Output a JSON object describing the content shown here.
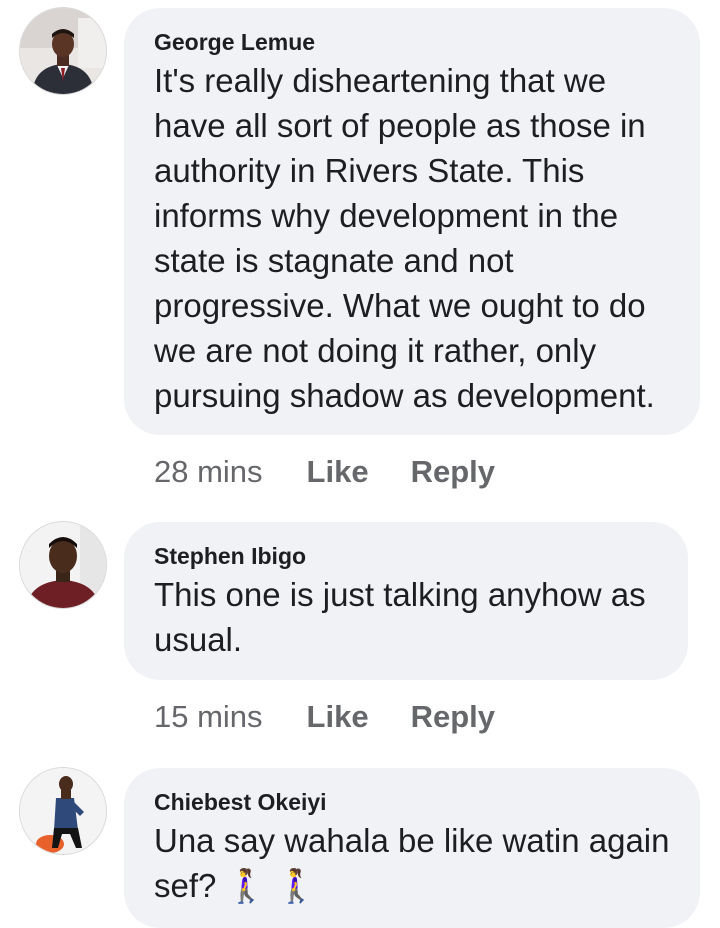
{
  "comments": [
    {
      "author": "George Lemue",
      "text": "It's really disheartening that we\nhave all sort of people as those in\nauthority  in Rivers State. This\ninforms why  development in the\nstate is stagnate and not\nprogressive. What we ought to do\nwe are not doing it rather, only\npursuing shadow as development.",
      "time": "28 mins",
      "like_label": "Like",
      "reply_label": "Reply"
    },
    {
      "author": "Stephen Ibigo",
      "text": "This one is just talking anyhow as\nusual.",
      "time": "15 mins",
      "like_label": "Like",
      "reply_label": "Reply"
    },
    {
      "author": "Chiebest Okeiyi",
      "text": "Una say wahala be like watin again\nsef? 🚶‍♀️ 🚶‍♀️",
      "time": "",
      "like_label": "",
      "reply_label": ""
    }
  ]
}
